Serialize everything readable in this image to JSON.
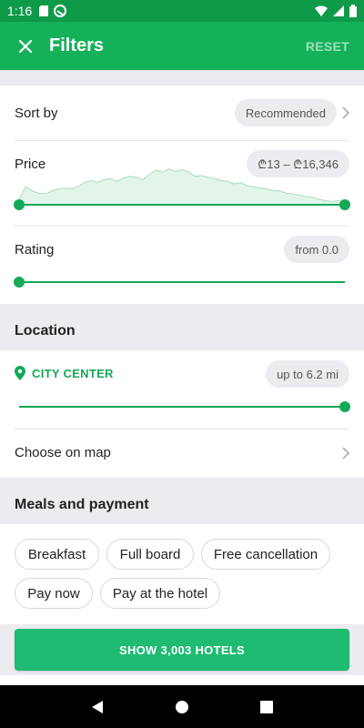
{
  "status_bar": {
    "time": "1:16"
  },
  "header": {
    "title": "Filters",
    "reset_label": "RESET"
  },
  "sort": {
    "label": "Sort by",
    "value": "Recommended"
  },
  "price": {
    "label": "Price",
    "value": "₾13 – ₾16,346",
    "histogram": [
      0.15,
      0.45,
      0.35,
      0.3,
      0.28,
      0.35,
      0.4,
      0.42,
      0.4,
      0.45,
      0.55,
      0.6,
      0.55,
      0.62,
      0.65,
      0.58,
      0.66,
      0.7,
      0.68,
      0.62,
      0.75,
      0.85,
      0.8,
      0.88,
      0.82,
      0.86,
      0.8,
      0.7,
      0.72,
      0.68,
      0.65,
      0.6,
      0.58,
      0.52,
      0.55,
      0.48,
      0.45,
      0.42,
      0.4,
      0.36,
      0.35,
      0.3,
      0.28,
      0.25,
      0.22,
      0.2,
      0.15,
      0.12,
      0.1,
      0.12,
      0.1
    ]
  },
  "rating": {
    "label": "Rating",
    "value": "from 0.0"
  },
  "location": {
    "title": "Location",
    "place": "CITY CENTER",
    "distance": "up to 6.2 mi",
    "choose_map": "Choose on map"
  },
  "meals": {
    "title": "Meals and payment",
    "chips": [
      "Breakfast",
      "Full board",
      "Free cancellation",
      "Pay now",
      "Pay at the hotel"
    ]
  },
  "cta": {
    "label": "SHOW 3,003 HOTELS"
  }
}
